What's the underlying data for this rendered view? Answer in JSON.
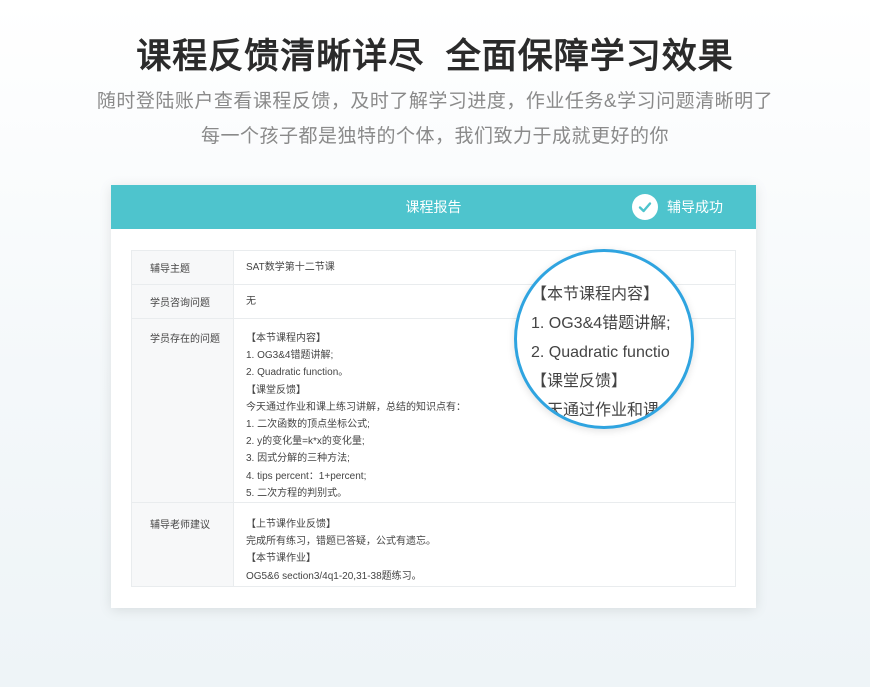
{
  "hero": {
    "headline": "课程反馈清晰详尽  全面保障学习效果",
    "subline1": "随时登陆账户查看课程反馈，及时了解学习进度，作业任务&学习问题清晰明了",
    "subline2": "每一个孩子都是独特的个体，我们致力于成就更好的你"
  },
  "card": {
    "title": "课程报告",
    "status_label": "辅导成功",
    "accent_color": "#4ec4cd",
    "rows": [
      {
        "label": "辅导主题",
        "lines": [
          "SAT数学第十二节课"
        ]
      },
      {
        "label": "学员咨询问题",
        "lines": [
          "无"
        ]
      },
      {
        "label": "学员存在的问题",
        "lines": [
          "【本节课程内容】",
          "1. OG3&4错题讲解;",
          "2. Quadratic function。",
          "【课堂反馈】",
          "今天通过作业和课上练习讲解，总结的知识点有：",
          "1. 二次函数的顶点坐标公式;",
          "2. y的变化量=k*x的变化量;",
          "3. 因式分解的三种方法;",
          "4. tips percent：1+percent;",
          "5. 二次方程的判别式。"
        ]
      },
      {
        "label": "辅导老师建议",
        "lines": [
          "【上节课作业反馈】",
          "完成所有练习，错题已答疑，公式有遗忘。",
          "【本节课作业】",
          "OG5&6 section3/4q1-20,31-38题练习。"
        ]
      }
    ]
  },
  "magnifier": {
    "border_color": "#2fa4e0",
    "lines": [
      "【本节课程内容】",
      "1. OG3&4错题讲解;",
      "2. Quadratic functio",
      "【课堂反馈】",
      "今天通过作业和课"
    ]
  }
}
